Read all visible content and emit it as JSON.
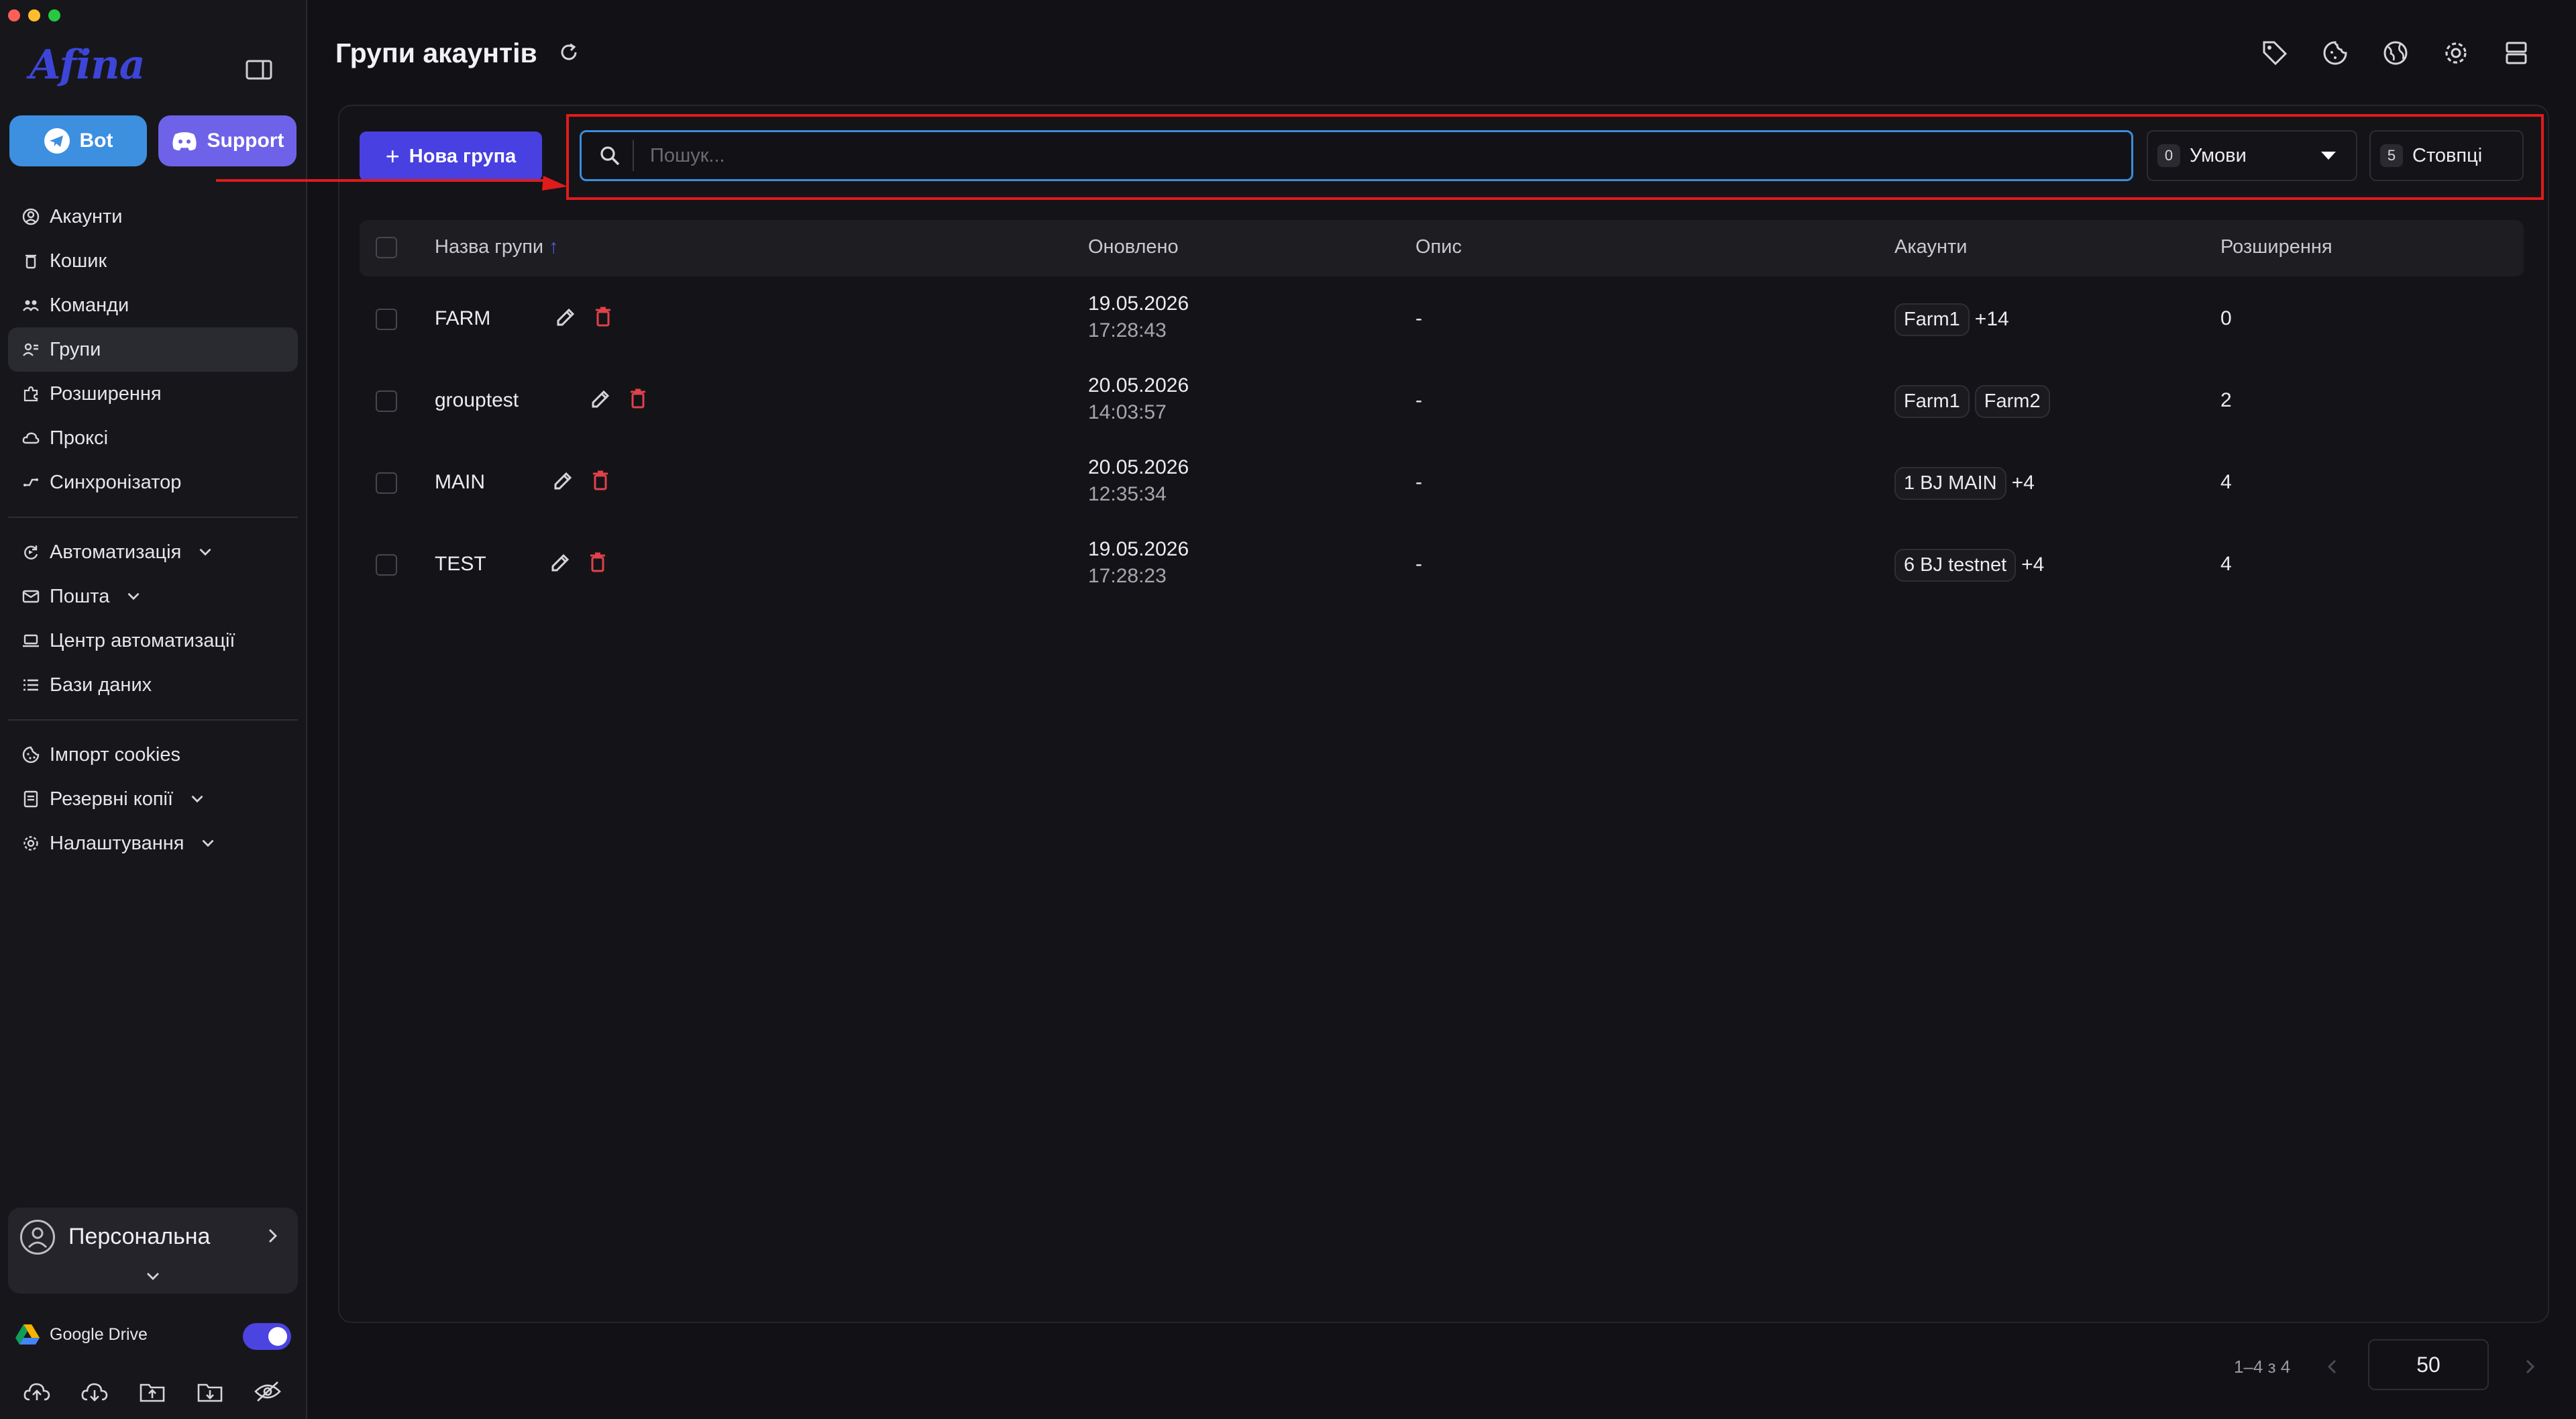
{
  "app": {
    "logo_text": "Afina"
  },
  "window_controls": {
    "close_color": "#ff5f57",
    "min_color": "#febc2e",
    "max_color": "#28c840"
  },
  "sidebar": {
    "promo": {
      "bot_label": "Bot",
      "support_label": "Support"
    },
    "nav_group1": [
      {
        "label": "Акаунти",
        "icon": "user-circle-icon"
      },
      {
        "label": "Кошик",
        "icon": "trash-icon"
      },
      {
        "label": "Команди",
        "icon": "team-icon"
      },
      {
        "label": "Групи",
        "icon": "group-icon",
        "active": true
      },
      {
        "label": "Розширення",
        "icon": "puzzle-icon"
      },
      {
        "label": "Проксі",
        "icon": "cloud-icon"
      },
      {
        "label": "Синхронізатор",
        "icon": "sync-icon"
      }
    ],
    "nav_group2": [
      {
        "label": "Автоматизація",
        "icon": "automation-icon",
        "expandable": true
      },
      {
        "label": "Пошта",
        "icon": "mail-icon",
        "expandable": true
      },
      {
        "label": "Центр автоматизації",
        "icon": "laptop-icon"
      },
      {
        "label": "Бази даних",
        "icon": "list-icon"
      }
    ],
    "nav_group3": [
      {
        "label": "Імпорт cookies",
        "icon": "cookie-icon"
      },
      {
        "label": "Резервні копії",
        "icon": "backup-icon",
        "expandable": true
      },
      {
        "label": "Налаштування",
        "icon": "gear-icon",
        "expandable": true
      }
    ],
    "profile": {
      "name": "Персональна"
    },
    "gdrive": {
      "label": "Google Drive",
      "enabled": true
    }
  },
  "header": {
    "title": "Групи акаунтів"
  },
  "toolbar": {
    "new_group_label": "Нова група",
    "search_placeholder": "Пошук...",
    "conditions_count": "0",
    "conditions_label": "Умови",
    "columns_count": "5",
    "columns_label": "Стовпці"
  },
  "table": {
    "columns": [
      "Назва групи",
      "Оновлено",
      "Опис",
      "Акаунти",
      "Розширення"
    ],
    "sort_indicator": "↑",
    "rows": [
      {
        "name": "FARM",
        "date": "19.05.2026",
        "time": "17:28:43",
        "description": "-",
        "chips": [
          "Farm1"
        ],
        "more": "+14",
        "extensions": "0"
      },
      {
        "name": "grouptest",
        "date": "20.05.2026",
        "time": "14:03:57",
        "description": "-",
        "chips": [
          "Farm1",
          "Farm2"
        ],
        "more": "",
        "extensions": "2"
      },
      {
        "name": "MAIN",
        "date": "20.05.2026",
        "time": "12:35:34",
        "description": "-",
        "chips": [
          "1 BJ MAIN"
        ],
        "more": "+4",
        "extensions": "4"
      },
      {
        "name": "TEST",
        "date": "19.05.2026",
        "time": "17:28:23",
        "description": "-",
        "chips": [
          "6 BJ testnet"
        ],
        "more": "+4",
        "extensions": "4"
      }
    ]
  },
  "pagination": {
    "range_label": "1–4 з 4",
    "page_size": "50"
  },
  "colors": {
    "accent": "#4840e0",
    "search_border": "#3b8ddb",
    "annotation": "#e01b1b",
    "delete": "#e0414b"
  }
}
